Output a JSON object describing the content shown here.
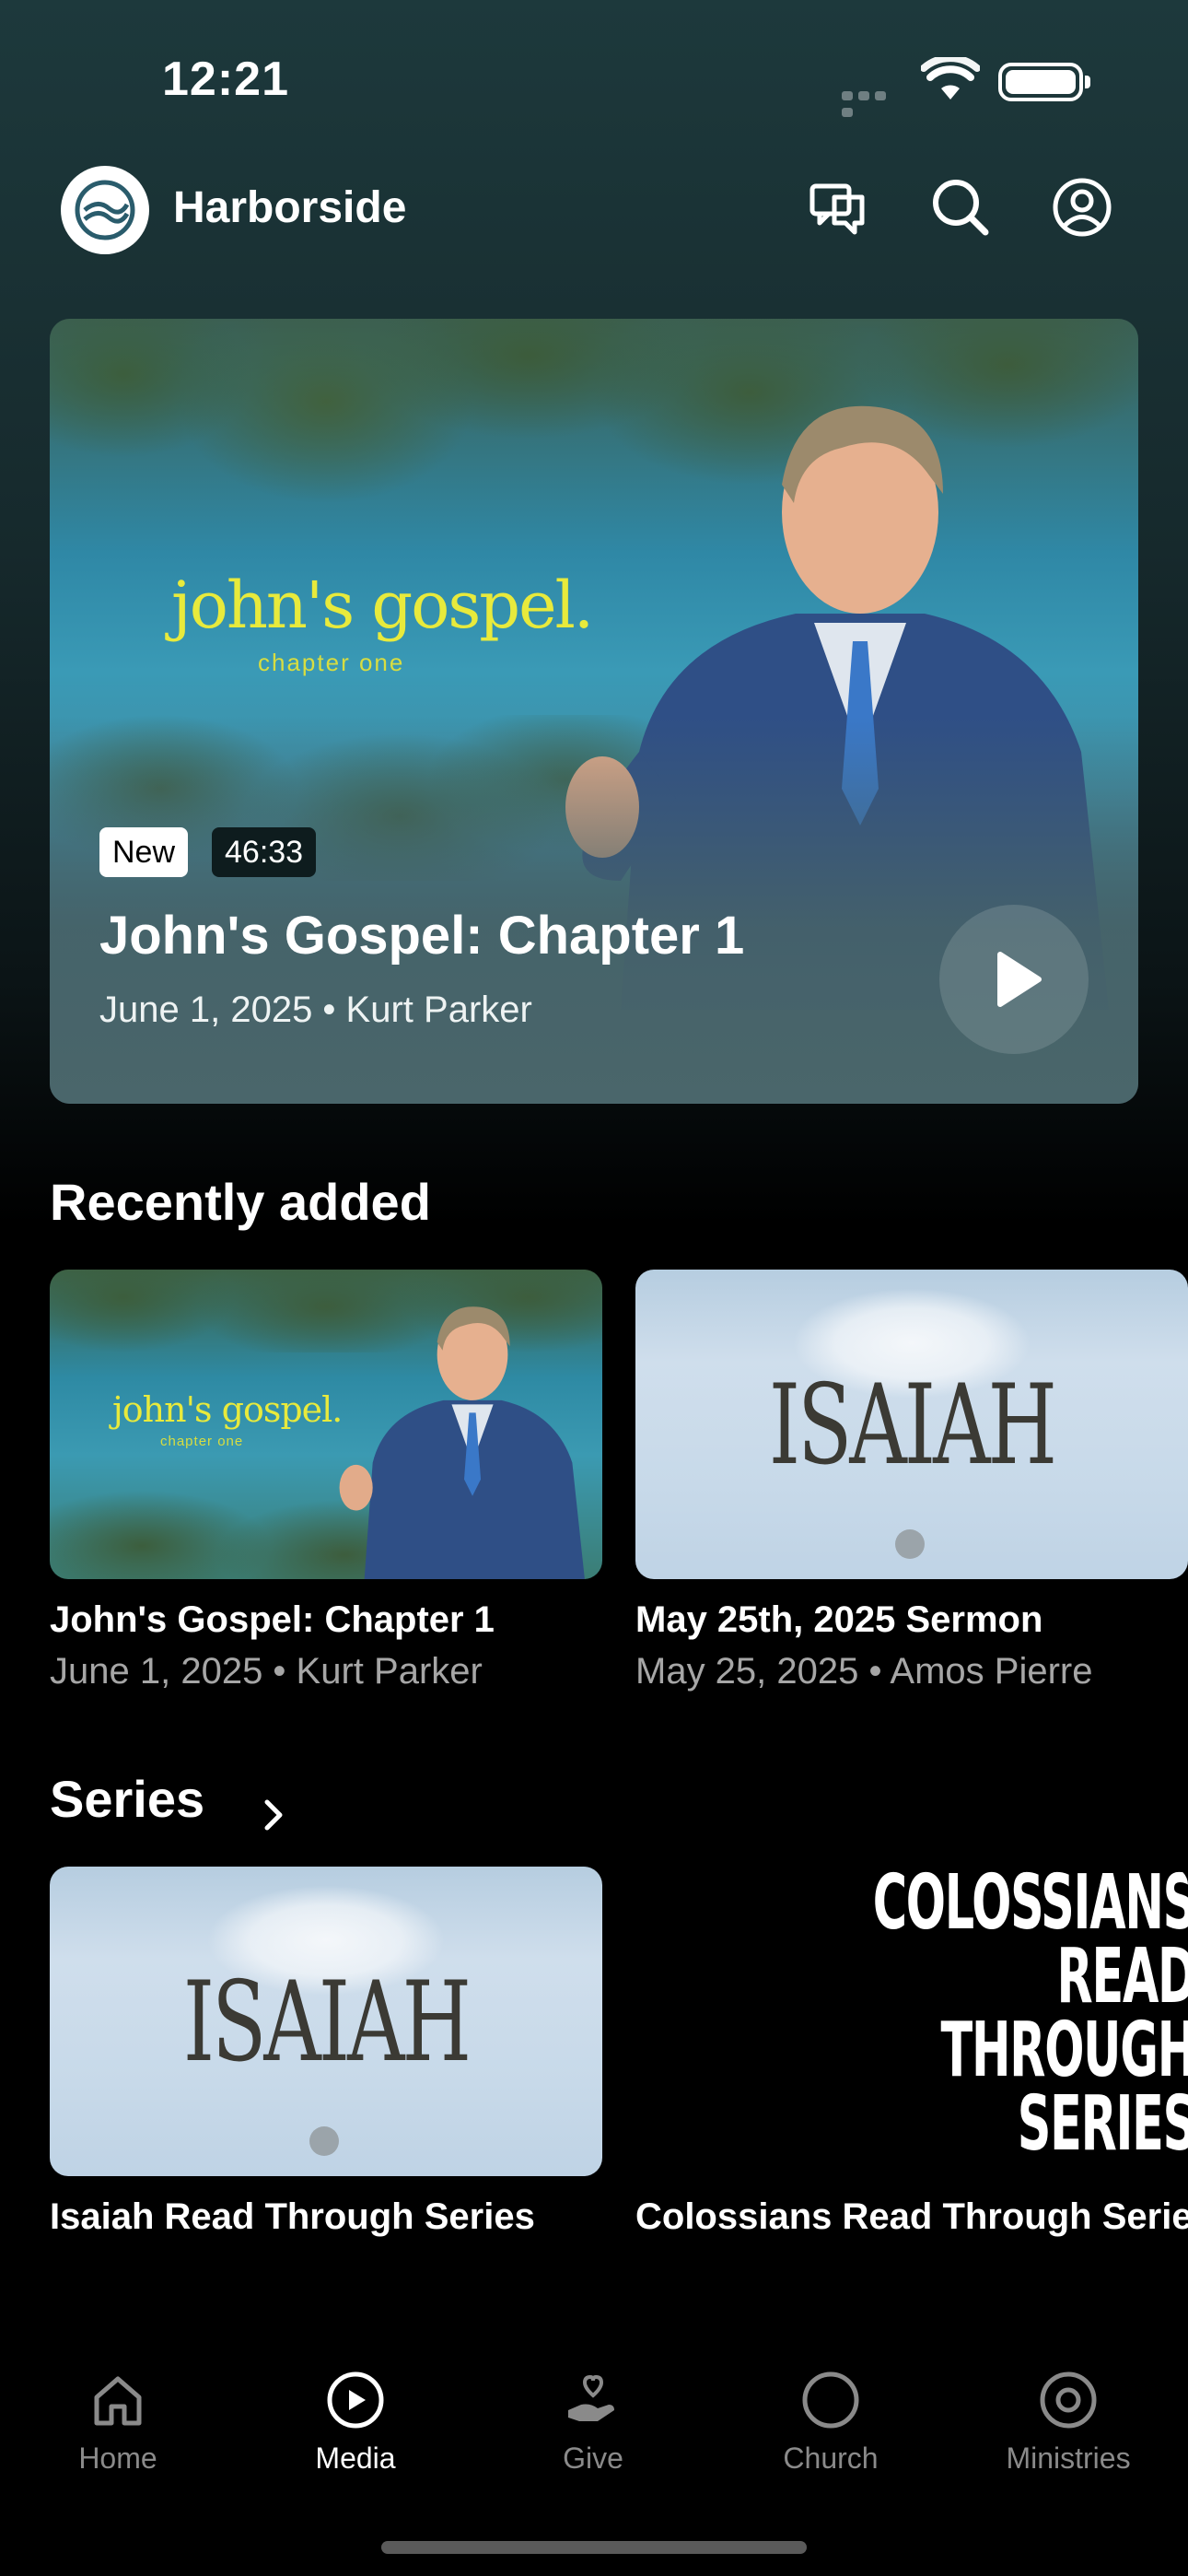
{
  "status": {
    "time": "12:21"
  },
  "header": {
    "title": "Harborside",
    "icons": [
      "chat-icon",
      "search-icon",
      "profile-icon"
    ]
  },
  "hero": {
    "art_title": "john's gospel.",
    "art_subtitle": "chapter one",
    "badge_new": "New",
    "duration": "46:33",
    "title": "John's Gospel: Chapter 1",
    "meta": "June 1, 2025 • Kurt Parker"
  },
  "recent": {
    "title": "Recently added",
    "items": [
      {
        "title": "John's Gospel: Chapter 1",
        "meta": "June 1, 2025 • Kurt Parker",
        "art_title": "john's gospel.",
        "art_subtitle": "chapter one"
      },
      {
        "title": "May 25th, 2025 Sermon",
        "meta": "May 25, 2025 • Amos Pierre",
        "art_title": "ISAIAH"
      }
    ]
  },
  "series": {
    "title": "Series",
    "items": [
      {
        "title": "Isaiah Read Through Series",
        "art_title": "ISAIAH"
      },
      {
        "title": "Colossians Read Through Series",
        "art_lines": [
          "COLOSSIANS",
          "READ",
          "THROUGH",
          "SERIES"
        ]
      }
    ]
  },
  "tabs": [
    {
      "label": "Home",
      "icon": "home-icon",
      "active": false
    },
    {
      "label": "Media",
      "icon": "play-circle-icon",
      "active": true
    },
    {
      "label": "Give",
      "icon": "give-hand-heart-icon",
      "active": false
    },
    {
      "label": "Church",
      "icon": "circle-icon",
      "active": false
    },
    {
      "label": "Ministries",
      "icon": "target-icon",
      "active": false
    }
  ],
  "colors": {
    "accent_art": "#e8ea3c",
    "tab_inactive": "#8a8a8a",
    "tab_active": "#ffffff"
  }
}
